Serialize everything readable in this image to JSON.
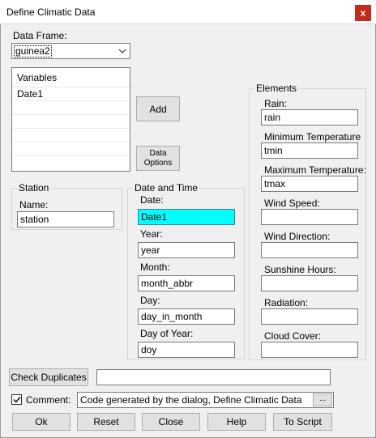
{
  "window": {
    "title": "Define Climatic Data",
    "close_label": "x"
  },
  "data_frame": {
    "label": "Data Frame:",
    "selected": "guinea2"
  },
  "variables": {
    "header": "Variables",
    "items": [
      "Date1",
      "",
      "",
      "",
      ""
    ]
  },
  "buttons": {
    "add": "Add",
    "data_options_line1": "Data",
    "data_options_line2": "Options",
    "check_duplicates": "Check Duplicates",
    "ellipsis": "...",
    "ok": "Ok",
    "reset": "Reset",
    "close": "Close",
    "help": "Help",
    "to_script": "To Script"
  },
  "station": {
    "group_title": "Station",
    "name_label": "Name:",
    "name_value": "station"
  },
  "date_time": {
    "group_title": "Date and Time",
    "date_label": "Date:",
    "date_value": "Date1",
    "year_label": "Year:",
    "year_value": "year",
    "month_label": "Month:",
    "month_value": "month_abbr",
    "day_label": "Day:",
    "day_value": "day_in_month",
    "doy_label": "Day of Year:",
    "doy_value": "doy"
  },
  "elements": {
    "group_title": "Elements",
    "rain_label": "Rain:",
    "rain_value": "rain",
    "tmin_label": "Minimum Temperature",
    "tmin_value": "tmin",
    "tmax_label": "Maximum Temperature:",
    "tmax_value": "tmax",
    "wind_speed_label": "Wind Speed:",
    "wind_speed_value": "",
    "wind_direction_label": "Wind Direction:",
    "wind_direction_value": "",
    "sunshine_label": "Sunshine Hours:",
    "sunshine_value": "",
    "radiation_label": "Radiation:",
    "radiation_value": "",
    "cloud_cover_label": "Cloud Cover:",
    "cloud_cover_value": ""
  },
  "duplicates": {
    "result_value": ""
  },
  "comment": {
    "label": "Comment:",
    "checked": true,
    "value": "Code generated by the dialog, Define Climatic Data"
  },
  "colors": {
    "active_field": "#00ffff",
    "close_button": "#c42b1c",
    "dialog_background": "#f0f0f0"
  }
}
